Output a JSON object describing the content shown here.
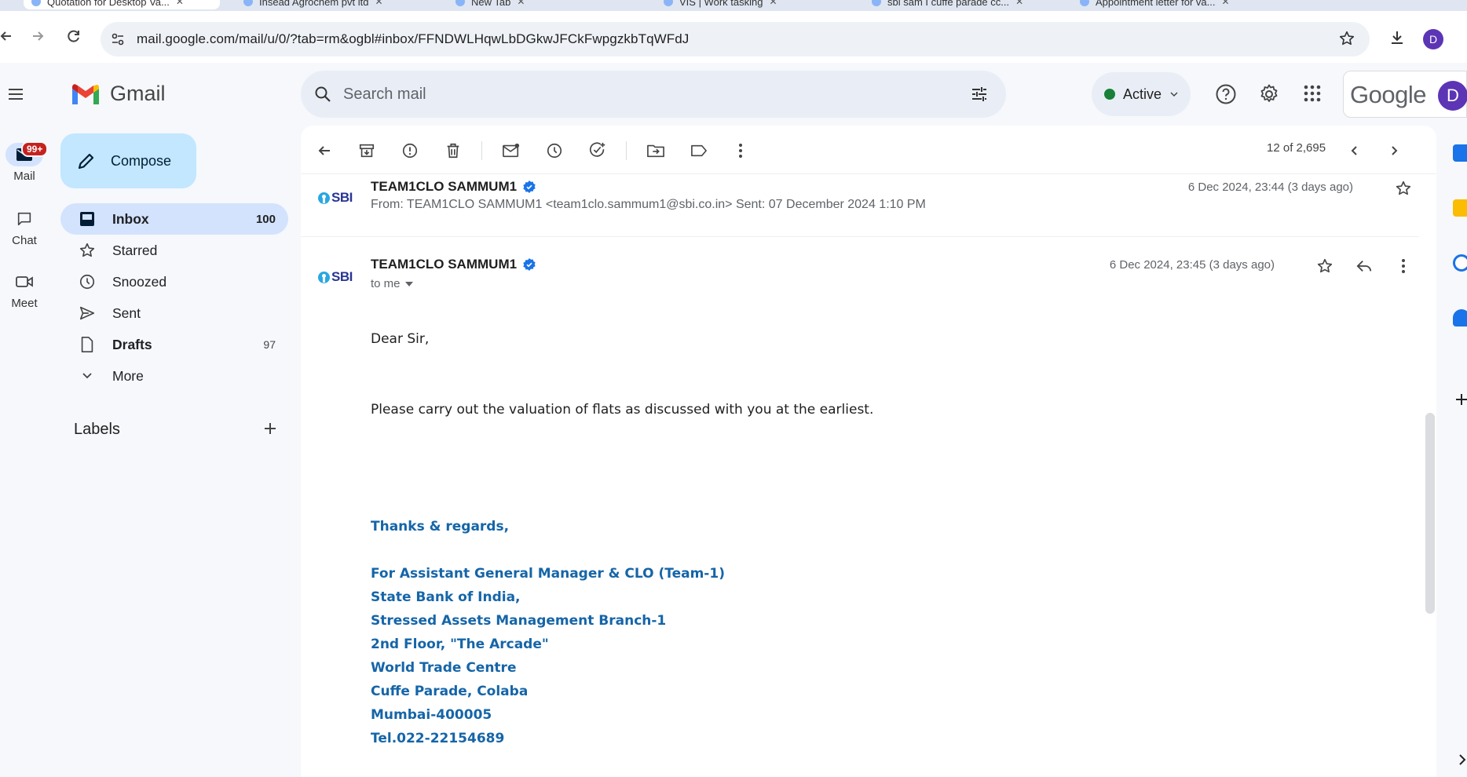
{
  "browser": {
    "tabs": [
      {
        "title": "Quotation for Desktop Va..."
      },
      {
        "title": "Insead Agrochem pvt ltd"
      },
      {
        "title": "New Tab"
      },
      {
        "title": "VIS | Work tasking"
      },
      {
        "title": "sbi sam I cuffe parade cc..."
      },
      {
        "title": "Appointment letter for va..."
      }
    ],
    "url": "mail.google.com/mail/u/0/?tab=rm&ogbl#inbox/FFNDWLHqwLbDGkwJFCkFwpgzkbTqWFdJ",
    "profile_initial": "D"
  },
  "gmail": {
    "brand": "Gmail",
    "search_placeholder": "Search mail",
    "status": "Active",
    "google_word": "Google",
    "account_initial": "D"
  },
  "rail": {
    "mail_label": "Mail",
    "mail_badge": "99+",
    "chat_label": "Chat",
    "meet_label": "Meet"
  },
  "sidebar": {
    "compose": "Compose",
    "items": [
      {
        "label": "Inbox",
        "count": "100"
      },
      {
        "label": "Starred",
        "count": ""
      },
      {
        "label": "Snoozed",
        "count": ""
      },
      {
        "label": "Sent",
        "count": ""
      },
      {
        "label": "Drafts",
        "count": "97"
      },
      {
        "label": "More",
        "count": ""
      }
    ],
    "labels_heading": "Labels"
  },
  "toolbar": {
    "pager": "12 of 2,695"
  },
  "thread": {
    "msg1": {
      "sender": "TEAM1CLO SAMMUM1",
      "logo": "SBI",
      "snippet": "From: TEAM1CLO SAMMUM1 <team1clo.sammum1@sbi.co.in> Sent: 07 December 2024 1:10 PM",
      "date": "6 Dec 2024, 23:44 (3 days ago)"
    },
    "msg2": {
      "sender": "TEAM1CLO SAMMUM1",
      "logo": "SBI",
      "to": "to me",
      "date": "6 Dec 2024, 23:45 (3 days ago)",
      "greeting": "Dear Sir,",
      "body": "Please carry out the valuation of flats as discussed with you at  the earliest.",
      "signature": [
        "Thanks & regards,",
        "For Assistant General Manager & CLO (Team-1)",
        "State Bank of India,",
        "Stressed Assets Management Branch-1",
        "2nd Floor, \"The Arcade\"",
        "World Trade Centre",
        "Cuffe Parade,  Colaba",
        "Mumbai-400005",
        "Tel.022-22154689"
      ]
    }
  },
  "colors": {
    "accent": "#0b57d0",
    "selected_bg": "#d3e3fd",
    "compose_bg": "#c2e7ff",
    "signature": "#1565a8",
    "badge": "#c5221f",
    "active_dot": "#188038"
  }
}
